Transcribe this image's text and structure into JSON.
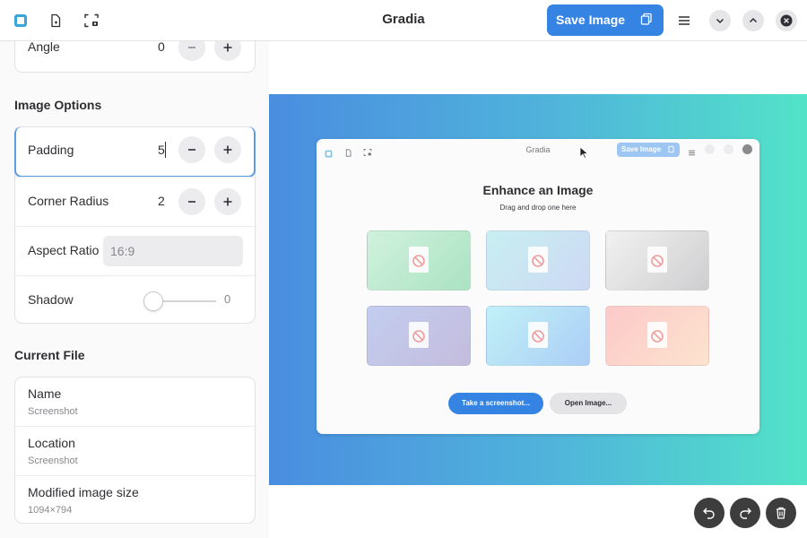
{
  "header": {
    "title": "Gradia",
    "save_label": "Save Image"
  },
  "sidebar": {
    "angle": {
      "label": "Angle",
      "value": "0"
    },
    "image_options": {
      "title": "Image Options",
      "padding": {
        "label": "Padding",
        "value": "5"
      },
      "corner_radius": {
        "label": "Corner Radius",
        "value": "2"
      },
      "aspect_ratio": {
        "label": "Aspect Ratio",
        "placeholder": "16:9"
      },
      "shadow": {
        "label": "Shadow",
        "value": "0"
      }
    },
    "current_file": {
      "title": "Current File",
      "name": {
        "label": "Name",
        "value": "Screenshot"
      },
      "location": {
        "label": "Location",
        "value": "Screenshot"
      },
      "size": {
        "label": "Modified image size",
        "value": "1094×794"
      }
    }
  },
  "preview": {
    "window_title": "Gradia",
    "save_label": "Save Image",
    "heading": "Enhance an Image",
    "subheading": "Drag and drop one here",
    "screenshot_button": "Take a screenshot...",
    "open_button": "Open Image...",
    "tiles": [
      {
        "bg": "linear-gradient(135deg,#c9f0d8,#9edfba)"
      },
      {
        "bg": "linear-gradient(135deg,#bfeef0,#c6d3f3)"
      },
      {
        "bg": "linear-gradient(135deg,#f0f0f0,#c7c7c9)"
      },
      {
        "bg": "linear-gradient(135deg,#b9c6ee,#bcb2d8)"
      },
      {
        "bg": "linear-gradient(135deg,#b7f0f7,#9ec6f5)"
      },
      {
        "bg": "linear-gradient(135deg,#fdc1c1,#fde0c6)"
      }
    ]
  },
  "colors": {
    "accent": "#3584e4",
    "gradient_start": "#4a8de0",
    "gradient_end": "#52e3c8",
    "focus": "#5b9be0"
  }
}
